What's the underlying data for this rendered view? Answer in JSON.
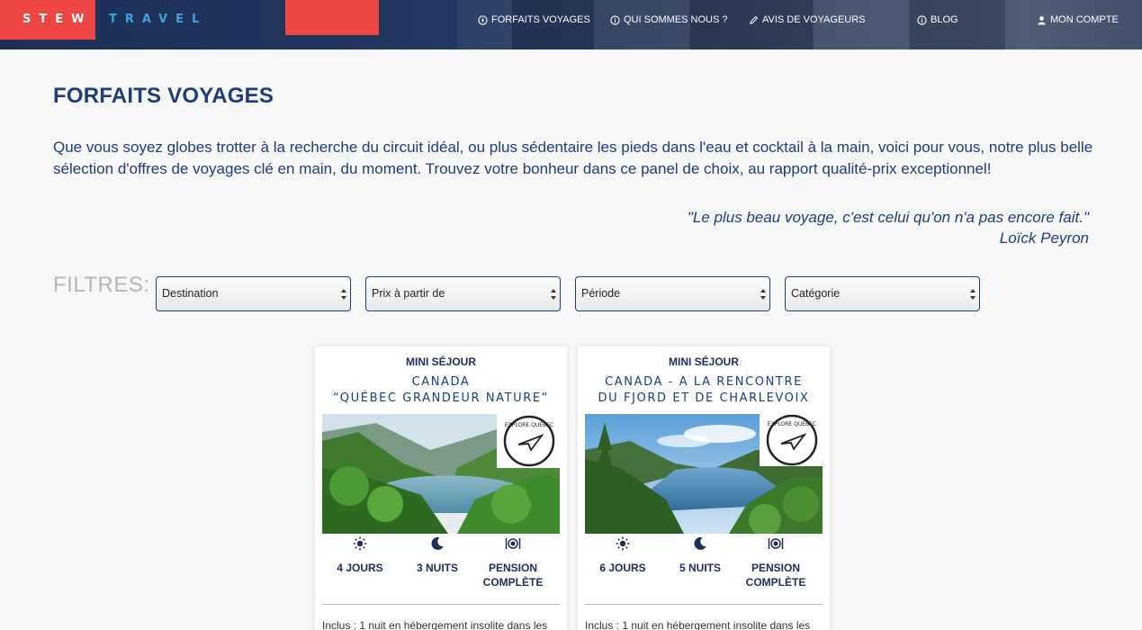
{
  "header": {
    "brand_first": "STEW",
    "brand_second": "TRAVEL",
    "nav": [
      {
        "label": "FORFAITS VOYAGES",
        "icon": "compass-icon"
      },
      {
        "label": "QUI SOMMES NOUS ?",
        "icon": "info-icon"
      },
      {
        "label": "AVIS DE VOYAGEURS",
        "icon": "pencil-icon"
      },
      {
        "label": "BLOG",
        "icon": "info-icon"
      },
      {
        "label": "MON COMPTE",
        "icon": "user-icon"
      }
    ]
  },
  "page": {
    "title": "FORFAITS VOYAGES",
    "intro": "Que vous soyez globes trotter à la recherche du circuit idéal, ou plus sédentaire les pieds dans l'eau et cocktail à la main, voici pour vous, notre plus belle sélection d'offres de voyages clé en main, du moment. Trouvez votre bonheur dans ce panel de choix, au rapport qualité-prix exceptionnel!",
    "quote": "\"Le plus beau voyage, c'est celui qu'on n'a pas encore fait.\"",
    "quote_author": "Loïck Peyron"
  },
  "filters": {
    "label": "FILTRES:",
    "selects": [
      "Destination",
      "Prix à partir de",
      "Période",
      "Catégorie"
    ]
  },
  "cards": [
    {
      "kind": "MINI SÉJOUR",
      "title_line1": "CANADA",
      "title_line2": "“QUÉBEC GRANDEUR NATURE“",
      "stamp_text": "EXPLORE QUÉBEC",
      "days": "4 JOURS",
      "nights": "3 NUITS",
      "board_line1": "PENSION",
      "board_line2": "COMPLÈTE",
      "inclus": "Inclus : 1 nuit en hébergement insolite dans les"
    },
    {
      "kind": "MINI SÉJOUR",
      "title_line1": "CANADA - A LA RENCONTRE",
      "title_line2": "DU FJORD ET DE CHARLEVOIX",
      "stamp_text": "EXPLORE QUÉBEC",
      "days": "6 JOURS",
      "nights": "5 NUITS",
      "board_line1": "PENSION",
      "board_line2": "COMPLÈTE",
      "inclus": "Inclus : 1 nuit en hébergement insolite dans les"
    }
  ],
  "colors": {
    "brand_red": "#ee4545",
    "brand_blue": "#3aa5df",
    "navy": "#1e3d7d",
    "header_bg": "#1c2f57"
  }
}
